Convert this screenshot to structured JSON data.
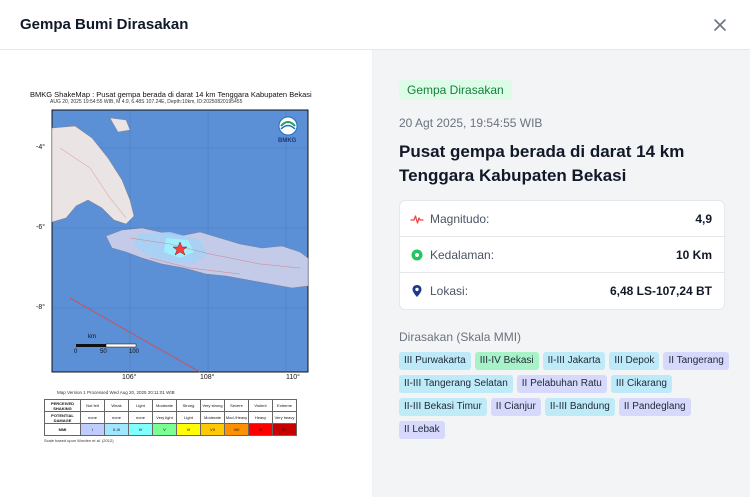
{
  "modal": {
    "title": "Gempa Bumi Dirasakan"
  },
  "shakemap": {
    "caption": "BMKG ShakeMap : Pusat gempa berada di darat 14 km Tenggara Kabupaten Bekasi",
    "subcaption": "AUG 20, 2025 19:54:55 WIB, M 4.9, 6.48S 107.24E, Depth:10km, ID:20250820195455",
    "logo_text": "BMKG",
    "lat_labels": [
      "-4°",
      "-6°",
      "-8°"
    ],
    "lon_labels": [
      "106°",
      "108°",
      "110°"
    ],
    "scale_unit": "km",
    "scale_ticks": [
      "0",
      "50",
      "100"
    ],
    "version_line": "Map Version 1 Processed Wed Aug 20, 2025 20:11:01 WIB",
    "legend_rows": {
      "perceived": [
        "PERCEIVED SHAKING",
        "Not felt",
        "Weak",
        "Light",
        "Moderate",
        "Strong",
        "Very strong",
        "Severe",
        "Violent",
        "Extreme"
      ],
      "damage": [
        "POTENTIAL DAMAGE",
        "none",
        "none",
        "none",
        "Very light",
        "Light",
        "Moderate",
        "Mod./Heavy",
        "Heavy",
        "Very heavy"
      ],
      "mmi": [
        "MMI",
        "I",
        "II-III",
        "IV",
        "V",
        "VI",
        "VII",
        "VIII",
        "IX",
        "X+"
      ]
    },
    "legend_colors": [
      "#ffffff",
      "#ffffff",
      "#bfccff",
      "#a0e6ff",
      "#80ffff",
      "#7aff93",
      "#ffff00",
      "#ffc800",
      "#ff9100",
      "#ff0000",
      "#c80000"
    ],
    "legend_note": "Scale based upon Worden et al. (2012)"
  },
  "detail": {
    "badge": "Gempa Dirasakan",
    "datetime": "20 Agt 2025, 19:54:55 WIB",
    "headline": "Pusat gempa berada di darat 14 km Tenggara Kabupaten Bekasi",
    "magnitude_label": "Magnitudo:",
    "magnitude_value": "4,9",
    "depth_label": "Kedalaman:",
    "depth_value": "10 Km",
    "location_label": "Lokasi:",
    "location_value": "6,48 LS-107,24 BT",
    "felt_title": "Dirasakan (Skala MMI)",
    "chips": [
      {
        "label": "III Purwakarta",
        "cls": "c3"
      },
      {
        "label": "III-IV Bekasi",
        "cls": "c34"
      },
      {
        "label": "II-III Jakarta",
        "cls": "c23"
      },
      {
        "label": "III Depok",
        "cls": "c3"
      },
      {
        "label": "II Tangerang",
        "cls": "c2"
      },
      {
        "label": "II-III Tangerang Selatan",
        "cls": "c23"
      },
      {
        "label": "II Pelabuhan Ratu",
        "cls": "c2"
      },
      {
        "label": "III Cikarang",
        "cls": "c3"
      },
      {
        "label": "II-III Bekasi Timur",
        "cls": "c23"
      },
      {
        "label": "II Cianjur",
        "cls": "c2"
      },
      {
        "label": "II-III Bandung",
        "cls": "c23"
      },
      {
        "label": "II Pandeglang",
        "cls": "c2"
      },
      {
        "label": "II Lebak",
        "cls": "c2"
      }
    ]
  },
  "colors": {
    "accent_green": "#15803d",
    "magnitude_icon": "#ef4444",
    "depth_icon": "#22c55e",
    "location_icon": "#1e3a8a"
  },
  "icons": {
    "close": "close-icon",
    "magnitude": "pulse-icon",
    "depth": "dot-icon",
    "location": "map-pin-icon"
  }
}
